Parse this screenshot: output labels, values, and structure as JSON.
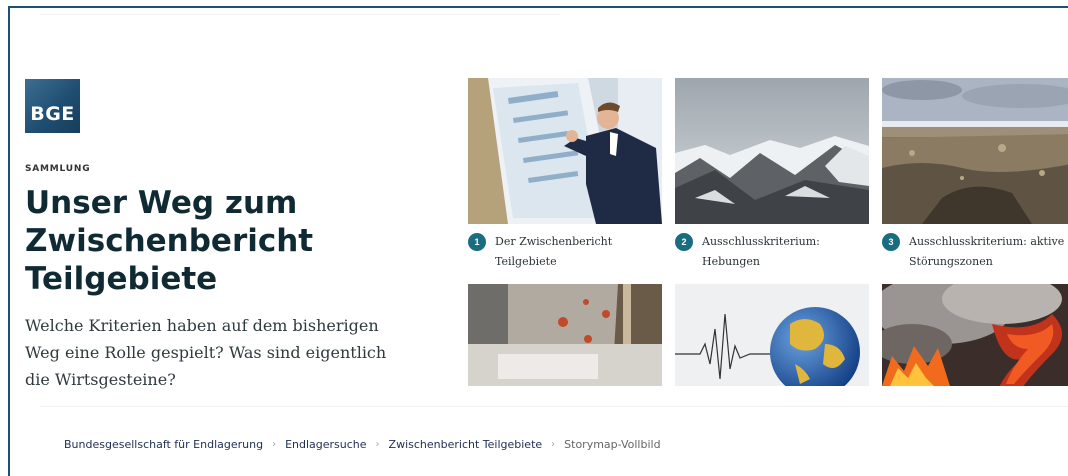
{
  "brand": {
    "logo_text": "BGE"
  },
  "hero": {
    "eyebrow": "SAMMLUNG",
    "title": "Unser Weg zum Zwischenbericht Teilgebiete",
    "lead": "Welche Kriterien haben auf dem bisherigen Weg eine Rolle gespielt? Was sind eigentlich die Wirtsgesteine?"
  },
  "tiles": [
    {
      "number": "1",
      "title": "Der Zwischenbericht Teilgebiete",
      "image": "presenter-with-poster"
    },
    {
      "number": "2",
      "title": "Ausschlusskriterium: Hebungen",
      "image": "snowy-mountains"
    },
    {
      "number": "3",
      "title": "Ausschlusskriterium: aktive Störungszonen",
      "image": "volcanic-landscape"
    },
    {
      "number": "",
      "title": "",
      "image": "underground-drilling-site"
    },
    {
      "number": "",
      "title": "",
      "image": "seismograph-globe"
    },
    {
      "number": "",
      "title": "",
      "image": "lava-eruption"
    }
  ],
  "breadcrumb": [
    {
      "label": "Bundesgesellschaft für Endlagerung"
    },
    {
      "label": "Endlagersuche"
    },
    {
      "label": "Zwischenbericht Teilgebiete"
    },
    {
      "label": "Storymap-Vollbild"
    }
  ],
  "colors": {
    "accent": "#1a6d80",
    "brand": "#1f4e72",
    "title": "#0f2a33"
  }
}
